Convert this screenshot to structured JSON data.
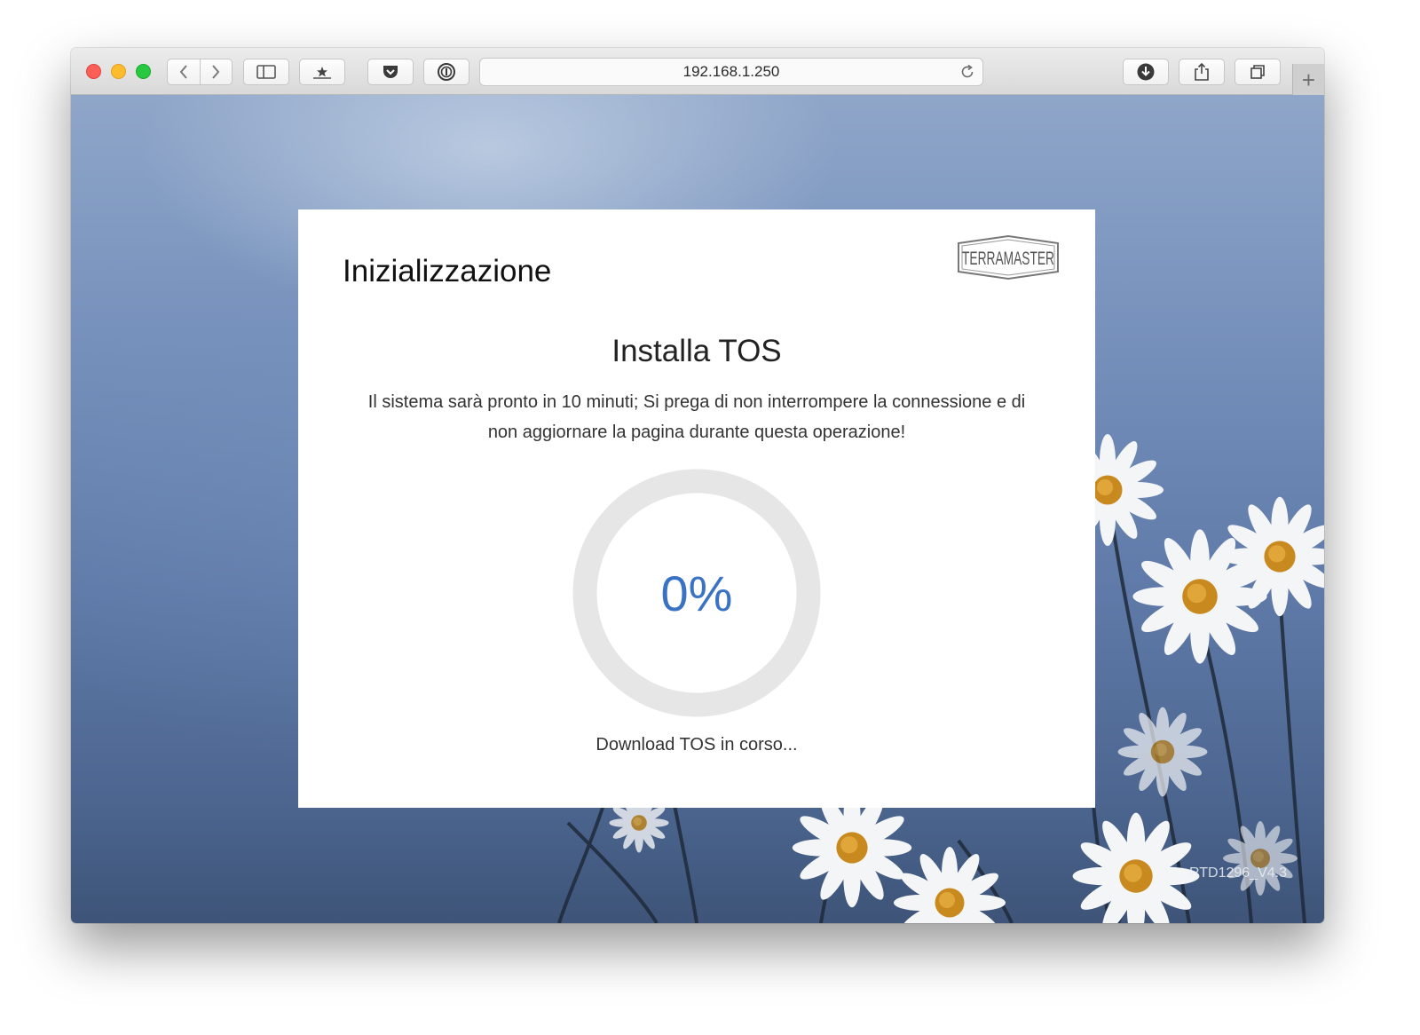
{
  "browser": {
    "url": "192.168.1.250",
    "new_tab_symbol": "+",
    "icons": [
      "back-icon",
      "forward-icon",
      "sidebar-icon",
      "bookmarks-icon",
      "pocket-icon",
      "password-icon",
      "reload-icon",
      "downloads-icon",
      "share-icon",
      "tabs-icon"
    ]
  },
  "card": {
    "title": "Inizializzazione",
    "logo_text": "TERRAMASTER",
    "install_title": "Installa TOS",
    "description": "Il sistema sarà pronto in 10 minuti; Si prega di non interrompere la connessione e di non aggiornare la pagina durante questa operazione!",
    "progress_percent": 0,
    "progress_label": "0%",
    "status": "Download TOS in corso..."
  },
  "footer": {
    "version": "RTD1296_V4.3"
  },
  "colors": {
    "accent": "#3a72c4",
    "ring_track": "#e6e6e6"
  }
}
